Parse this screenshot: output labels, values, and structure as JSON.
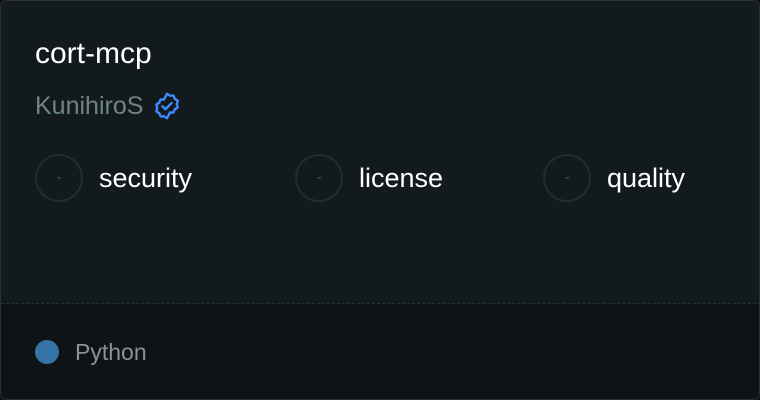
{
  "repo": {
    "name": "cort-mcp",
    "owner": "KunihiroS",
    "verified_icon": "verified-badge-icon"
  },
  "scores": [
    {
      "value": "-",
      "label": "security"
    },
    {
      "value": "-",
      "label": "license"
    },
    {
      "value": "-",
      "label": "quality"
    }
  ],
  "footer": {
    "language": "Python",
    "language_color": "#3572a5"
  },
  "colors": {
    "card_background": "#121a1d",
    "footer_background": "#0e1416",
    "owner_text": "#6e8580",
    "verified_badge": "#3d8bfd"
  }
}
